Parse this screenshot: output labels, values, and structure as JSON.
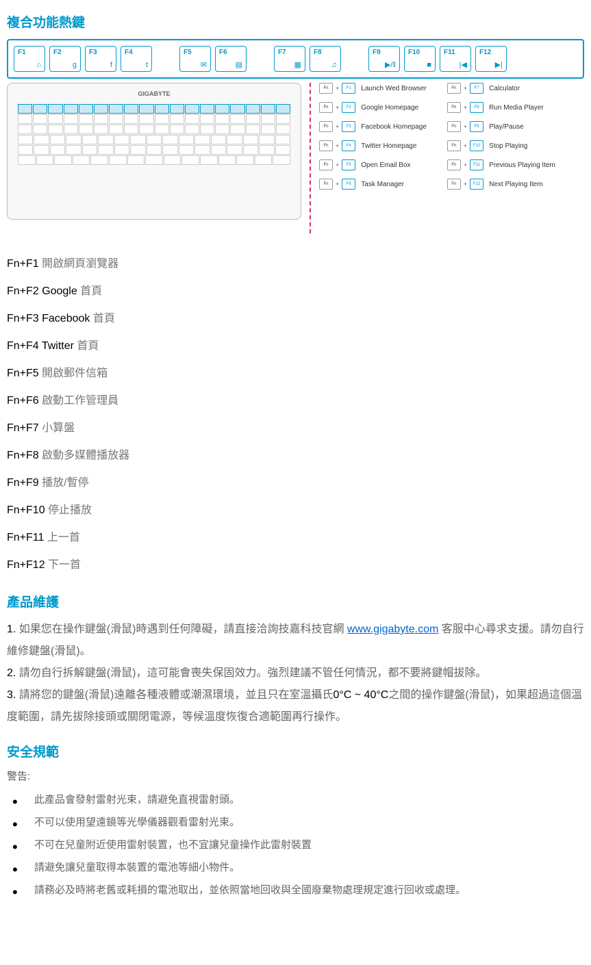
{
  "heading_hotkeys": "複合功能熱鍵",
  "fkeys": [
    {
      "label": "F1",
      "icon": "⌂"
    },
    {
      "label": "F2",
      "icon": "g"
    },
    {
      "label": "F3",
      "icon": "f"
    },
    {
      "label": "F4",
      "icon": "t"
    },
    {
      "label": "F5",
      "icon": "✉"
    },
    {
      "label": "F6",
      "icon": "▤"
    },
    {
      "label": "F7",
      "icon": "▦"
    },
    {
      "label": "F8",
      "icon": "♫"
    },
    {
      "label": "F9",
      "icon": "▶/‖"
    },
    {
      "label": "F10",
      "icon": "■"
    },
    {
      "label": "F11",
      "icon": "|◀"
    },
    {
      "label": "F12",
      "icon": "▶|"
    }
  ],
  "keyboard_brand": "GIGABYTE",
  "shortcuts_left": [
    {
      "k": "F1",
      "label": "Launch Wed Browser"
    },
    {
      "k": "F2",
      "label": "Google Homepage"
    },
    {
      "k": "F3",
      "label": "Facebook Homepage"
    },
    {
      "k": "F4",
      "label": "Twitter Homepage"
    },
    {
      "k": "F5",
      "label": "Open Email Box"
    },
    {
      "k": "F6",
      "label": "Task Manager"
    }
  ],
  "shortcuts_right": [
    {
      "k": "F7",
      "label": "Calculator"
    },
    {
      "k": "F8",
      "label": "Run Media Player"
    },
    {
      "k": "F9",
      "label": "Play/Pause"
    },
    {
      "k": "F10",
      "label": "Stop Playing"
    },
    {
      "k": "F11",
      "label": "Previous Playing Item"
    },
    {
      "k": "F12",
      "label": "Next Playing Item"
    }
  ],
  "fn_list": [
    {
      "key": "Fn+F1",
      "desc": "開啟網頁瀏覽器"
    },
    {
      "key": "Fn+F2 Google",
      "desc": "首頁"
    },
    {
      "key": "Fn+F3 Facebook",
      "desc": "首頁"
    },
    {
      "key": "Fn+F4 Twitter",
      "desc": "首頁"
    },
    {
      "key": "Fn+F5",
      "desc": "開啟郵件信箱"
    },
    {
      "key": "Fn+F6",
      "desc": "啟動工作管理員"
    },
    {
      "key": "Fn+F7",
      "desc": "小算盤"
    },
    {
      "key": "Fn+F8",
      "desc": "啟動多媒體播放器"
    },
    {
      "key": "Fn+F9",
      "desc": "播放/暫停"
    },
    {
      "key": "Fn+F10",
      "desc": "停止播放"
    },
    {
      "key": "Fn+F11",
      "desc": "上一首"
    },
    {
      "key": "Fn+F12",
      "desc": "下一首"
    }
  ],
  "heading_maint": "產品維護",
  "maint_1_pre": "1.",
  "maint_1_a": "如果您在操作鍵盤(滑鼠)時遇到任何障礙，請直接洽詢技嘉科技官網",
  "maint_link": "www.gigabyte.com",
  "maint_1_b": "客服中心尋求支援。請勿自行維修鍵盤(滑鼠)。",
  "maint_2_pre": "2.",
  "maint_2": "請勿自行拆解鍵盤(滑鼠)，這可能會喪失保固效力。強烈建議不管任何情況，都不要將鍵帽拔除。",
  "maint_3_pre": "3.",
  "maint_3_a": "請將您的鍵盤(滑鼠)遠離各種液體或潮濕環境，並且只在室溫攝氏",
  "maint_3_temp": "0°C ~ 40°C",
  "maint_3_b": "之間的操作鍵盤(滑鼠)，如果超過這個溫度範圍，請先拔除接頭或關閉電源，等候溫度恢復合適範圍再行操作。",
  "heading_safety": "安全規範",
  "warn_label": "警告:",
  "bullets": [
    "此產品會發射雷射光束，請避免直視雷射頭。",
    "不可以使用望遠鏡等光學儀器觀看雷射光束。",
    "不可在兒童附近使用雷射裝置，也不宜讓兒童操作此雷射裝置",
    "請避免讓兒童取得本裝置的電池等細小物件。",
    "請務必及時將老舊或耗損的電池取出，並依照當地回收與全國廢棄物處理規定進行回收或處理。"
  ],
  "fn_label": "Fn",
  "plus": "+"
}
